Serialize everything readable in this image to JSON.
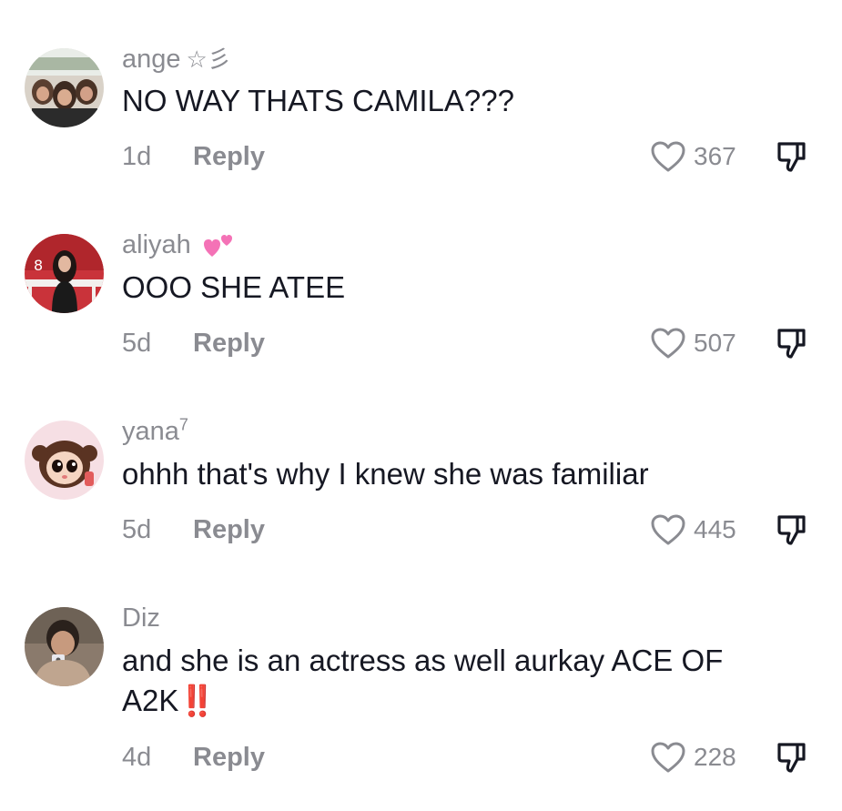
{
  "comments": [
    {
      "username": "ange",
      "badge": "☆彡",
      "text": "NO WAY THATS CAMILA???",
      "age": "1d",
      "reply_label": "Reply",
      "likes": "367"
    },
    {
      "username": "aliyah",
      "badge": "💕",
      "text": "OOO SHE ATEE",
      "age": "5d",
      "reply_label": "Reply",
      "likes": "507"
    },
    {
      "username": "yana",
      "superscript": "7",
      "text": "ohhh that's why I knew she was familiar",
      "age": "5d",
      "reply_label": "Reply",
      "likes": "445"
    },
    {
      "username": "Diz",
      "text": "and she is an actress as well aurkay ACE OF A2K",
      "emphasis": "‼️",
      "age": "4d",
      "reply_label": "Reply",
      "likes": "228"
    }
  ],
  "colors": {
    "primary_text": "#161823",
    "secondary_text": "#8a8b91",
    "emphasis_red": "#e0142a"
  },
  "icons": {
    "like": "heart-outline-icon",
    "dislike": "thumbs-down-icon"
  }
}
